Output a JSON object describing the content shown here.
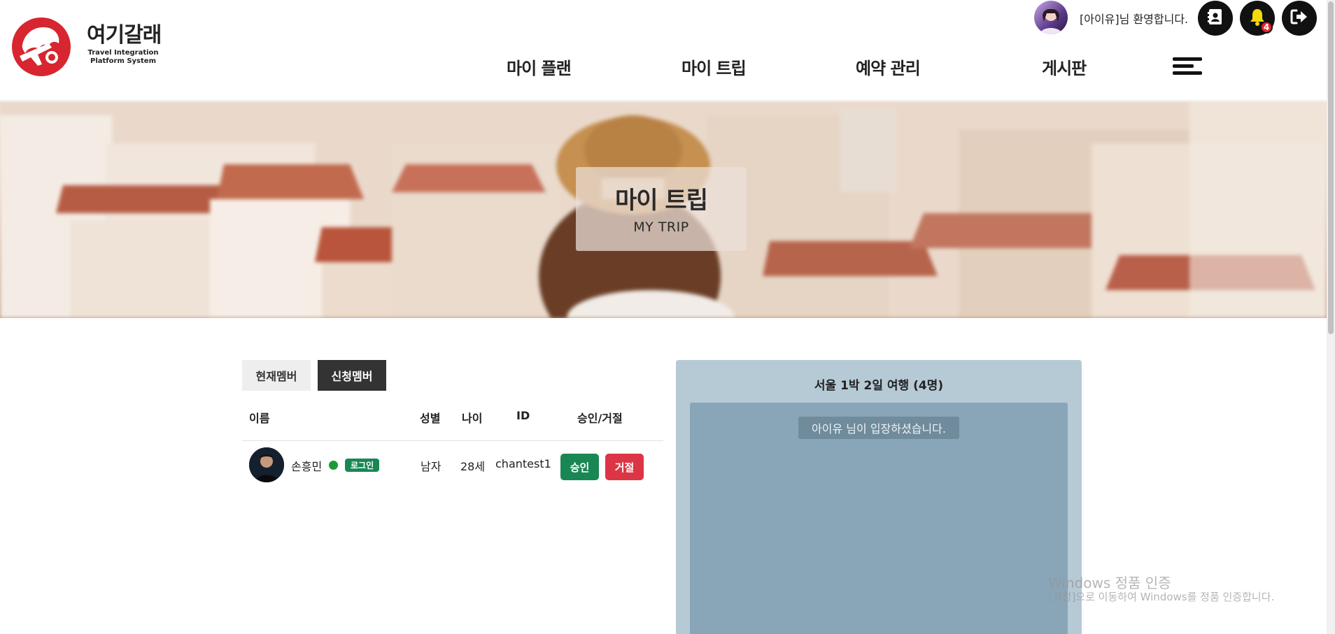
{
  "brand": {
    "title": "여기갈래",
    "subtitle_line1": "Travel Integration",
    "subtitle_line2": "Platform System",
    "logo_color": "#d7262f"
  },
  "nav": {
    "items": [
      "마이 플랜",
      "마이 트립",
      "예약 관리",
      "게시판"
    ],
    "menu_icon": "hamburger-icon"
  },
  "user": {
    "welcome": "[아이유]님 환영합니다.",
    "notification_count": "4",
    "icons": [
      "profile-card-icon",
      "bell-icon",
      "logout-icon"
    ]
  },
  "hero": {
    "title": "마이 트립",
    "subtitle": "MY TRIP"
  },
  "tabs": {
    "current": "현재멤버",
    "apply": "신청멤버",
    "active": "apply"
  },
  "table": {
    "headers": [
      "이름",
      "성별",
      "나이",
      "ID",
      "승인/거절"
    ],
    "rows": [
      {
        "name": "손흥민",
        "status_badge": "로그인",
        "gender": "남자",
        "age": "28세",
        "id": "chantest1",
        "approve_label": "승인",
        "reject_label": "거절"
      }
    ]
  },
  "chat": {
    "title": "서울 1박 2일 여행 (4명)",
    "notice": "아이유 님이 입장하셨습니다."
  },
  "watermark": {
    "line1": "Windows 정품 인증",
    "line2": "[설정]으로 이동하여 Windows를 정품 인증합니다."
  },
  "colors": {
    "approve": "#198754",
    "reject": "#dc3545",
    "online": "#1a9a32",
    "chat_panel": "#b6cad6",
    "chat_body": "#89a6b8"
  }
}
